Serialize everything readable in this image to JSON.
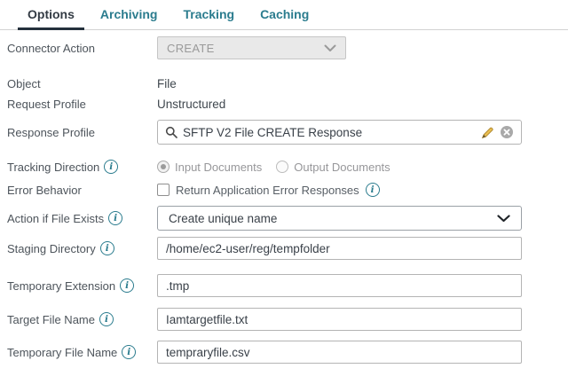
{
  "tabs": [
    {
      "label": "Options",
      "active": true
    },
    {
      "label": "Archiving",
      "active": false
    },
    {
      "label": "Tracking",
      "active": false
    },
    {
      "label": "Caching",
      "active": false
    }
  ],
  "form": {
    "connector_action": {
      "label": "Connector Action",
      "value": "CREATE",
      "disabled": true
    },
    "object": {
      "label": "Object",
      "value": "File"
    },
    "request_profile": {
      "label": "Request Profile",
      "value": "Unstructured"
    },
    "response_profile": {
      "label": "Response Profile",
      "value": "SFTP V2 File CREATE Response"
    },
    "tracking_direction": {
      "label": "Tracking Direction",
      "options": [
        {
          "label": "Input Documents",
          "selected": true,
          "disabled": true
        },
        {
          "label": "Output Documents",
          "selected": false,
          "disabled": true
        }
      ]
    },
    "error_behavior": {
      "label": "Error Behavior",
      "checkbox_label": "Return Application Error Responses",
      "checked": false
    },
    "action_if_file_exists": {
      "label": "Action if File Exists",
      "value": "Create unique name"
    },
    "staging_directory": {
      "label": "Staging Directory",
      "value": "/home/ec2-user/reg/tempfolder"
    },
    "temporary_extension": {
      "label": "Temporary Extension",
      "value": ".tmp"
    },
    "target_file_name": {
      "label": "Target File Name",
      "value": "Iamtargetfile.txt"
    },
    "temporary_file_name": {
      "label": "Temporary File Name",
      "value": "tempraryfile.csv"
    }
  },
  "icons": {
    "search": "magnifying-glass",
    "edit": "pencil",
    "clear": "circle-x",
    "info": "italic-i-circle",
    "chevron": "chevron-down"
  },
  "colors": {
    "accent_teal": "#2b7c8e",
    "active_tab_text": "#333b44",
    "active_tab_underline": "#24303c",
    "label_text": "#4d545b",
    "disabled_text": "#9a9a9a",
    "disabled_bg": "#e9e9e9",
    "input_border": "#b4b4b4",
    "tab_divider": "#d2d2d2"
  }
}
